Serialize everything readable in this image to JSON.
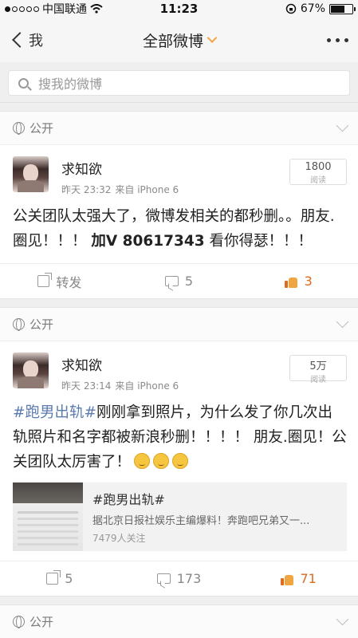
{
  "status": {
    "carrier": "中国联通",
    "time": "11:23",
    "battery_pct": "67%",
    "battery_level": 0.67
  },
  "nav": {
    "back_label": "我",
    "title": "全部微博"
  },
  "search": {
    "placeholder": "搜我的微博"
  },
  "posts": [
    {
      "visibility": "公开",
      "user": "求知欲",
      "time": "昨天 23:32",
      "source": "来自 iPhone 6",
      "reads_count": "1800",
      "reads_label": "阅读",
      "text_main": "公关团队太强大了，微博发相关的都秒删。。朋友.圈见！！！ ",
      "text_bold": "加V 80617343",
      "text_tail": " 看你得瑟！！！",
      "repost_label": "转发",
      "comments": "5",
      "likes": "3"
    },
    {
      "visibility": "公开",
      "user": "求知欲",
      "time": "昨天 23:14",
      "source": "来自 iPhone 6",
      "reads_count": "5万",
      "reads_label": "阅读",
      "tag": "#跑男出轨#",
      "text_main": "刚刚拿到照片，为什么发了你几次出轨照片和名字都被新浪秒删！！！！ 朋友.圈见！公关团队太厉害了！",
      "embed": {
        "title": "#跑男出轨#",
        "desc": "据北京日报社娱乐主编爆料！奔跑吧兄弟又一...",
        "sub": "7479人关注"
      },
      "reposts": "5",
      "comments": "173",
      "likes": "71"
    },
    {
      "visibility": "公开"
    }
  ],
  "colors": {
    "accent": "#f0a640",
    "like": "#e06a1e",
    "topic": "#5b7bb0"
  }
}
